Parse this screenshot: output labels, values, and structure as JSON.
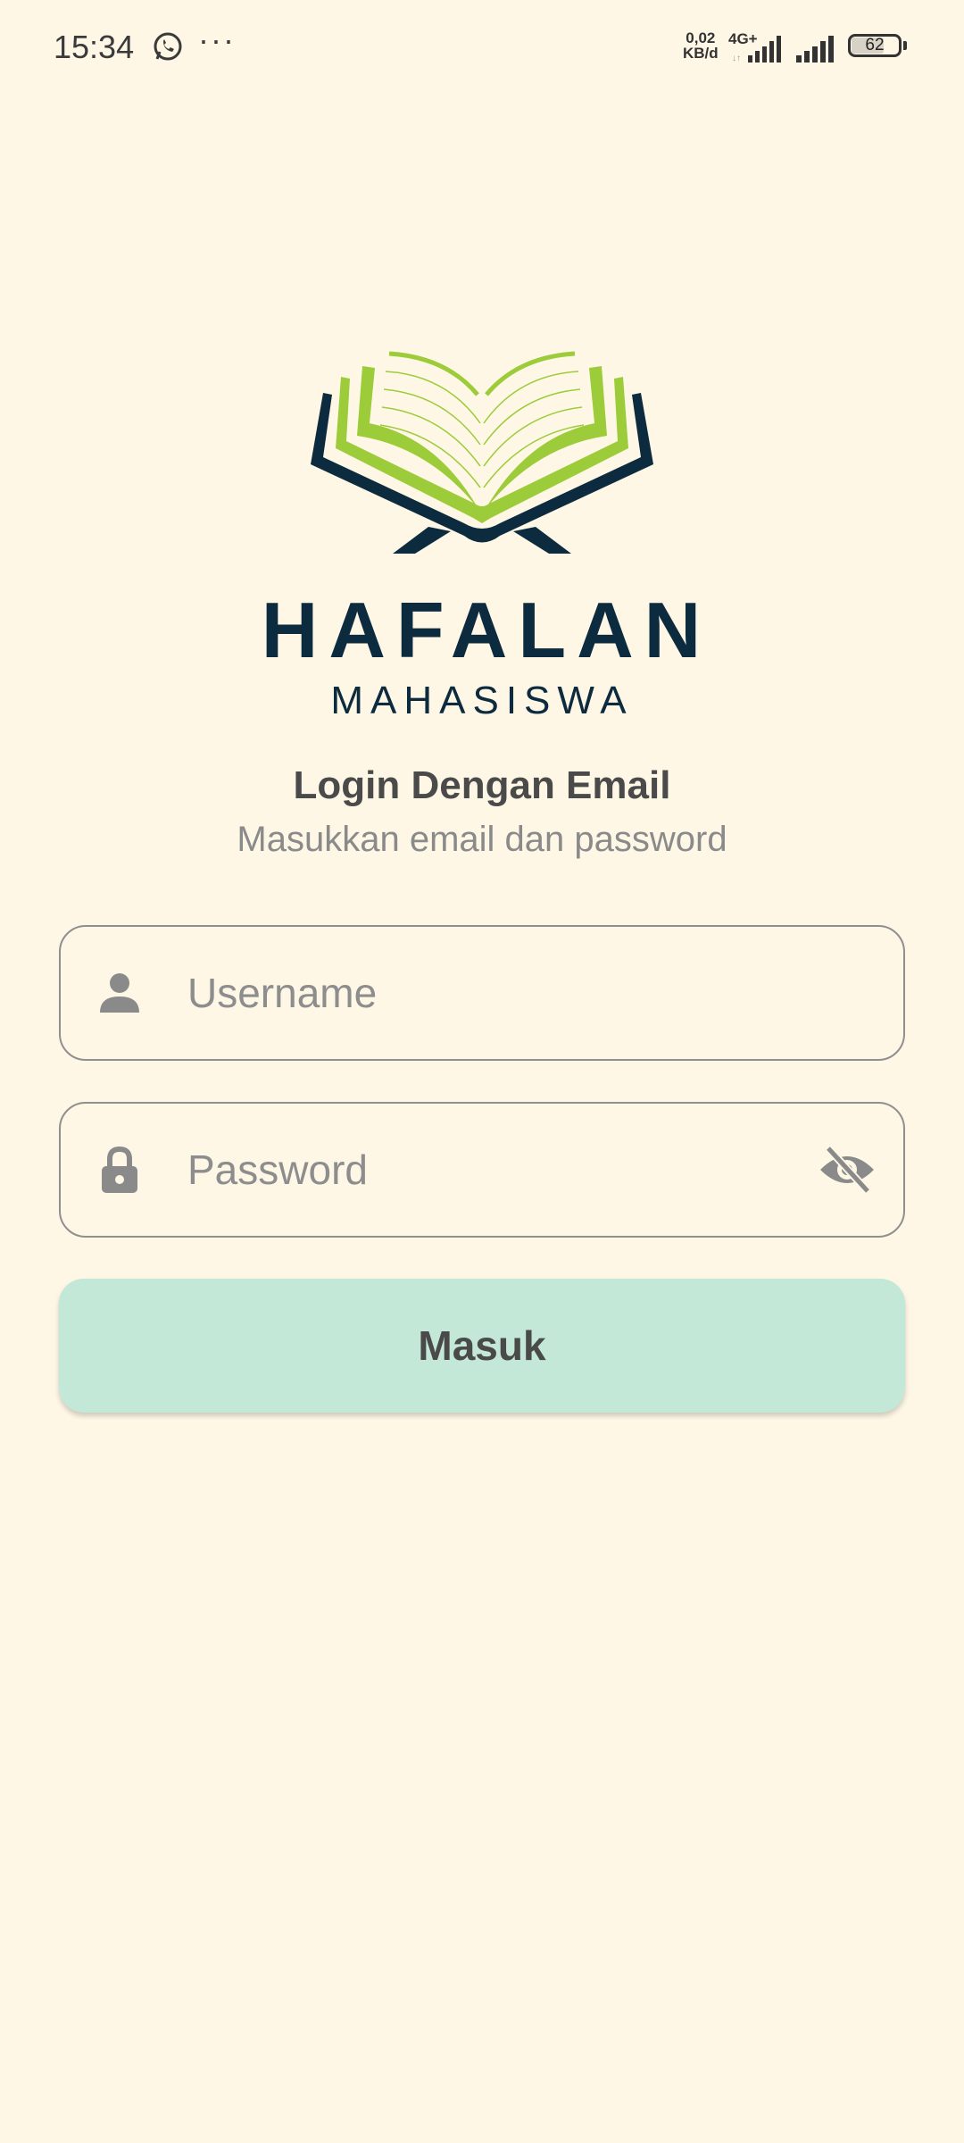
{
  "status_bar": {
    "time": "15:34",
    "more": "···",
    "speed_value": "0,02",
    "speed_unit": "KB/d",
    "network": "4G+",
    "battery": "62"
  },
  "brand": {
    "title": "HAFALAN",
    "subtitle": "MAHASISWA"
  },
  "login": {
    "heading": "Login Dengan Email",
    "subheading": "Masukkan email dan password",
    "username_placeholder": "Username",
    "password_placeholder": "Password",
    "submit_label": "Masuk"
  },
  "colors": {
    "background": "#fef7e6",
    "brand_navy": "#0d2b3e",
    "brand_green": "#9dcc3a",
    "button_bg": "#c3e8d7"
  },
  "icons": {
    "username": "person-icon",
    "password": "lock-icon",
    "visibility": "eye-off-icon"
  }
}
